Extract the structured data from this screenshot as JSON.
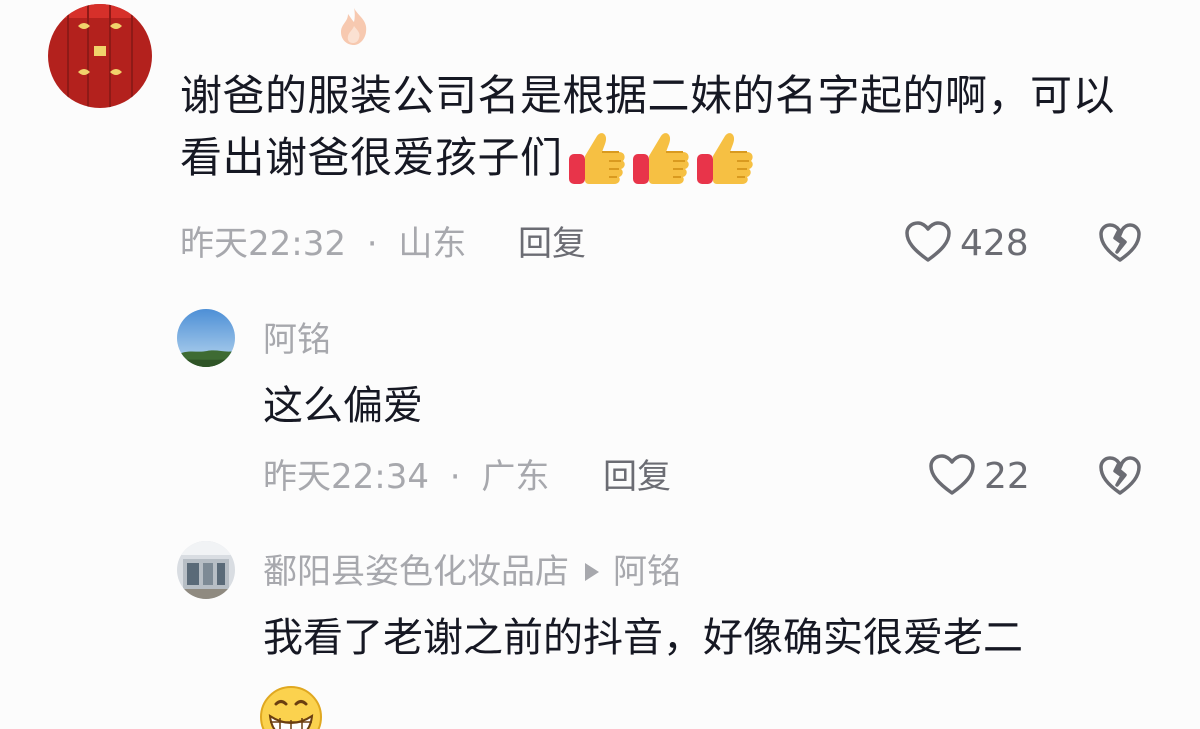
{
  "comments": [
    {
      "text_line1": "谢爸的服装公司名是根据二妹的名字起的啊，可以",
      "text_line2": "看出谢爸很爱孩子们",
      "emojis": [
        "thumbs-up",
        "thumbs-up",
        "thumbs-up"
      ],
      "time": "昨天22:32",
      "separator": "·",
      "location": "山东",
      "reply_label": "回复",
      "like_count": "428"
    },
    {
      "author": "阿铭",
      "text": "这么偏爱",
      "time": "昨天22:34",
      "separator": "·",
      "location": "广东",
      "reply_label": "回复",
      "like_count": "22"
    },
    {
      "author": "鄱阳县姿色化妆品店",
      "reply_to": "阿铭",
      "text": "我看了老谢之前的抖音，好像确实很爱老二",
      "emoji": "grinning-face"
    }
  ],
  "colors": {
    "background": "#fcfcfc",
    "text_primary": "#161823",
    "text_meta": "#a7a8ad",
    "text_reply": "#6b6c73"
  }
}
